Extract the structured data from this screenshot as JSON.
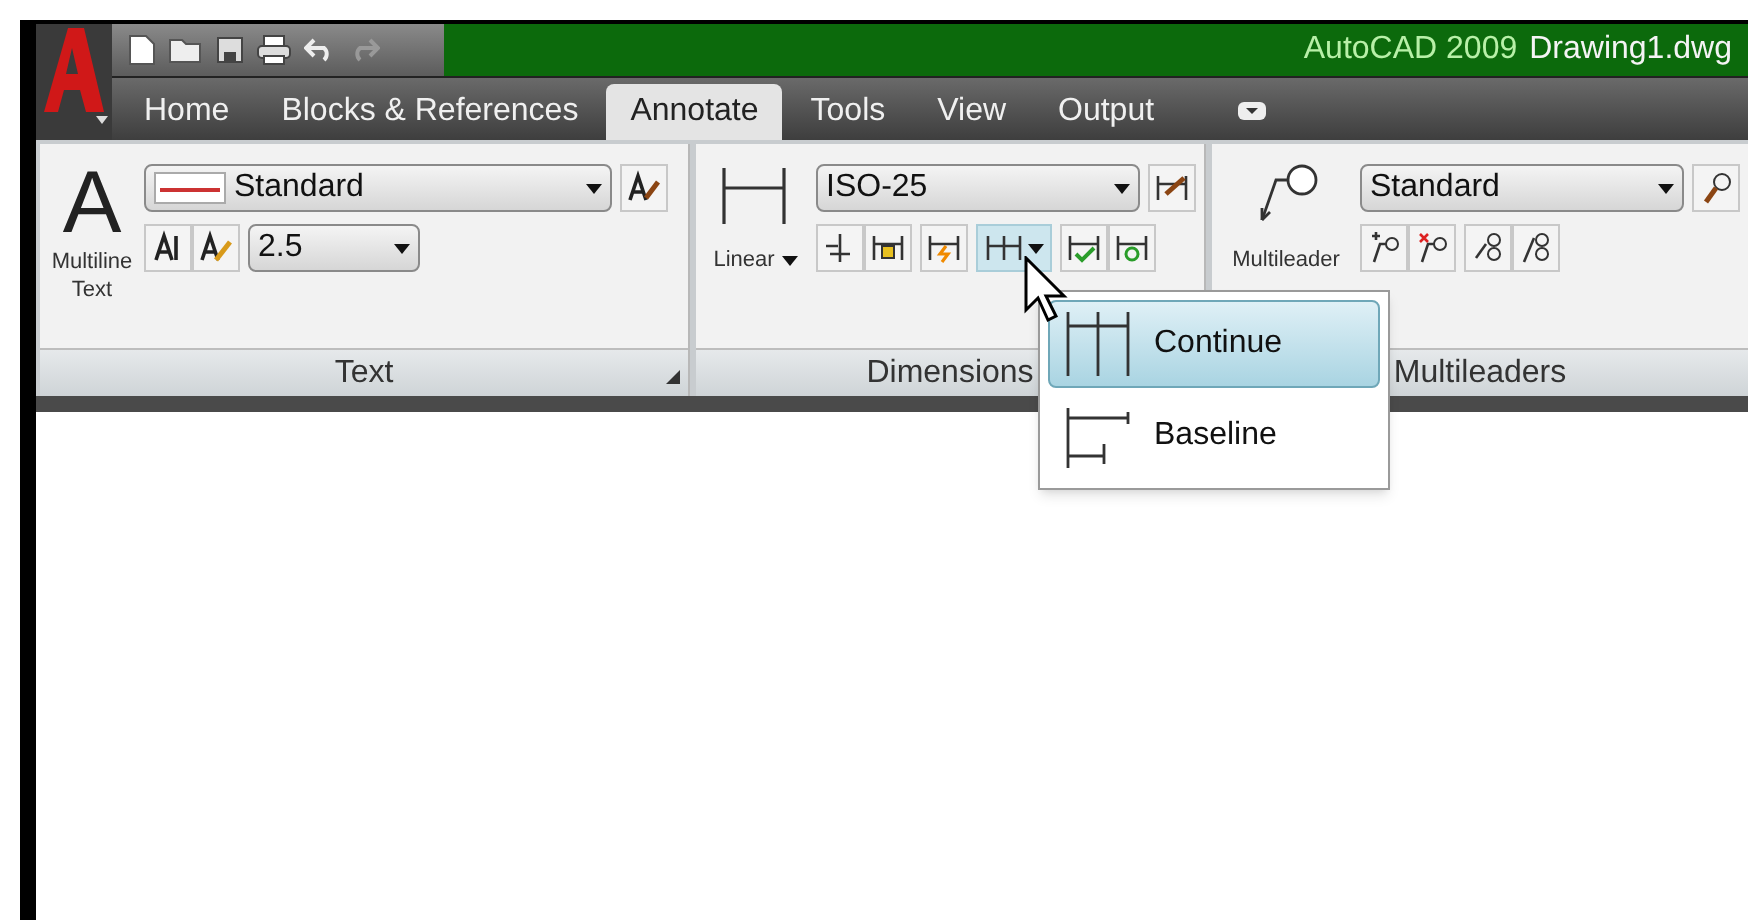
{
  "window": {
    "app_title": "AutoCAD 2009",
    "document_title": "Drawing1.dwg"
  },
  "tabs": [
    {
      "label": "Home",
      "selected": false
    },
    {
      "label": "Blocks & References",
      "selected": false
    },
    {
      "label": "Annotate",
      "selected": true
    },
    {
      "label": "Tools",
      "selected": false
    },
    {
      "label": "View",
      "selected": false
    },
    {
      "label": "Output",
      "selected": false
    }
  ],
  "panels": [
    {
      "kind": "text",
      "title": "Text",
      "big_button": "Multiline Text",
      "big_icon": "A",
      "style_combo": "Standard",
      "height_combo": "2.5"
    },
    {
      "kind": "dimensions",
      "title": "Dimensions",
      "big_button": "Linear",
      "style_combo": "ISO-25"
    },
    {
      "kind": "multileaders",
      "title": "Multileaders",
      "big_button": "Multileader",
      "style_combo": "Standard"
    }
  ],
  "dropdown_menu": {
    "items": [
      {
        "label": "Continue",
        "selected": true
      },
      {
        "label": "Baseline",
        "selected": false
      }
    ]
  }
}
